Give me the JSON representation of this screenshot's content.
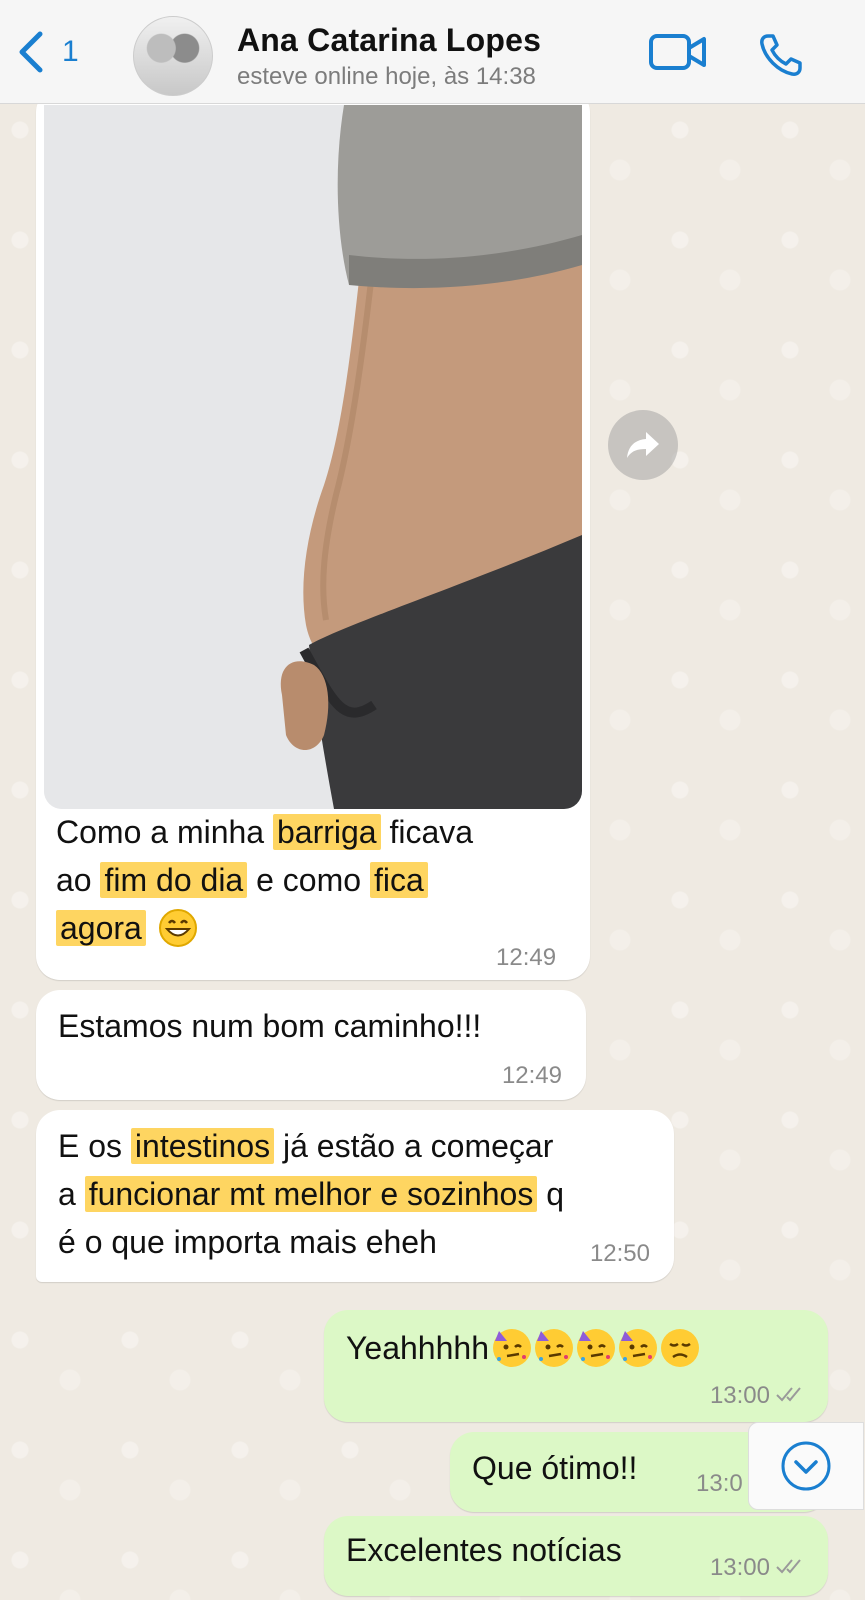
{
  "header": {
    "back_count": "1",
    "contact_name": "Ana Catarina Lopes",
    "status": "esteve online hoje, às 14:38"
  },
  "messages": [
    {
      "direction": "in",
      "has_photo": true,
      "parts": [
        "Como a minha ",
        "barriga",
        " ficava ",
        "ao ",
        "fim do dia",
        " e como ",
        "fica ",
        "agora"
      ],
      "time": "12:49"
    },
    {
      "direction": "in",
      "text": "Estamos num bom caminho!!!",
      "time": "12:49"
    },
    {
      "direction": "in",
      "parts": [
        "E os ",
        "intestinos",
        " já estão a começar",
        "a ",
        "funcionar mt melhor e sozinhos",
        " q",
        "é o que importa mais eheh"
      ],
      "time": "12:50"
    },
    {
      "direction": "out",
      "text": "Yeahhhhh",
      "time": "13:00"
    },
    {
      "direction": "out",
      "text": "Que ótimo!!",
      "time": "13:0"
    },
    {
      "direction": "out",
      "text": "Excelentes notícias",
      "time": "13:00"
    }
  ],
  "icons": {
    "back": "chevron-left-icon",
    "video": "video-camera-icon",
    "call": "phone-icon",
    "share": "forward-arrow-icon",
    "scroll": "chevron-down-icon",
    "read": "double-check-icon"
  },
  "colors": {
    "accent": "#1a7fd0",
    "incoming_bubble": "#ffffff",
    "outgoing_bubble": "#dcf8c6",
    "highlight": "#fed561"
  }
}
